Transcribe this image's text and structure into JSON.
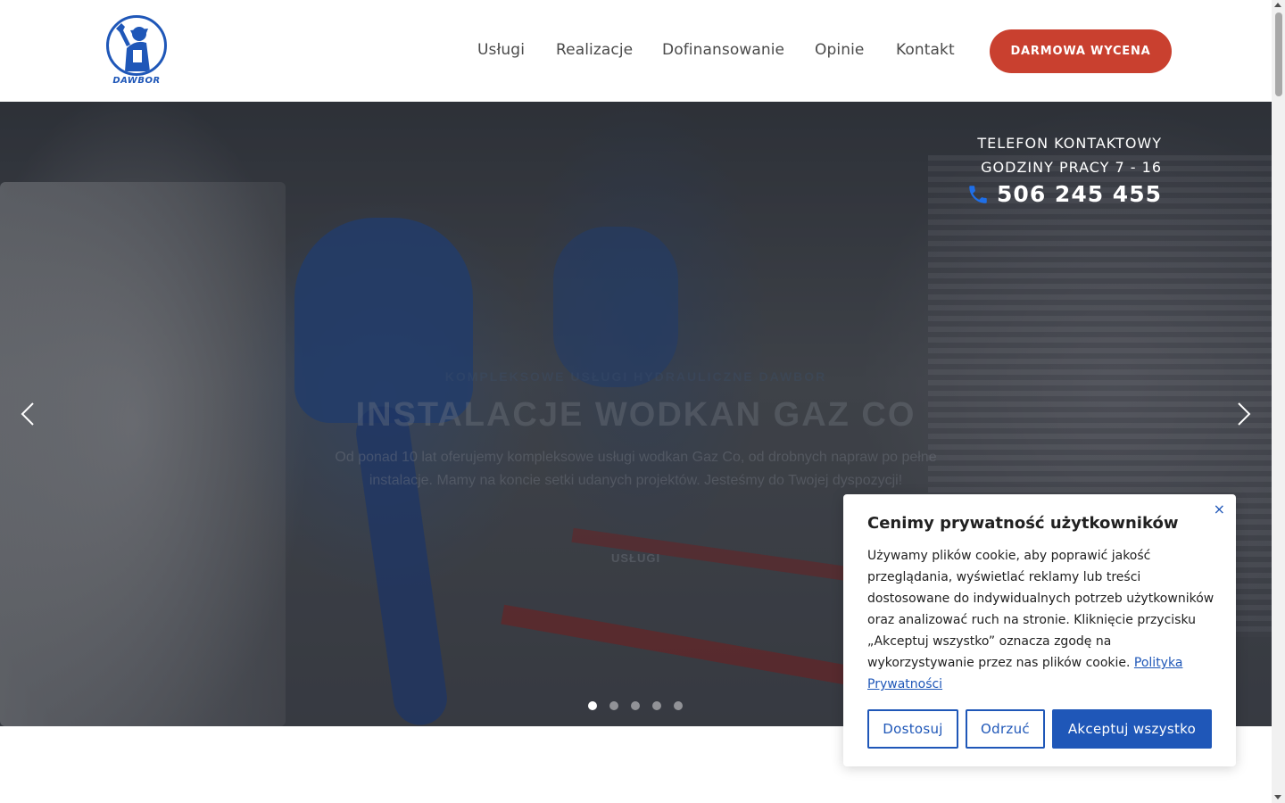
{
  "header": {
    "logo_text": "DAWBOR",
    "nav": [
      "Usługi",
      "Realizacje",
      "Dofinansowanie",
      "Opinie",
      "Kontakt"
    ],
    "cta_label": "DARMOWA WYCENA"
  },
  "hero": {
    "contact_label": "TELEFON KONTAKTOWY",
    "hours": "GODZINY PRACY 7 - 16",
    "phone": "506 245 455",
    "slide": {
      "subtitle": "KOMPLEKSOWE USŁUGI HYDRAULICZNE DAWBOR",
      "title": "INSTALACJE WODKAN GAZ CO",
      "text": "Od ponad 10 lat oferujemy kompleksowe usługi wodkan Gaz Co, od drobnych napraw po pełne instalacje. Mamy na koncie setki udanych projektów. Jesteśmy do Twojej dyspozycji!",
      "button": "USŁUGI"
    },
    "slides_count": 5,
    "active_slide": 1
  },
  "cookie": {
    "title": "Cenimy prywatność użytkowników",
    "body": "Używamy plików cookie, aby poprawić jakość przeglądania, wyświetlać reklamy lub treści dostosowane do indywidualnych potrzeb użytkowników oraz analizować ruch na stronie. Kliknięcie przycisku „Akceptuj wszystko” oznacza zgodę na wykorzystywanie przez nas plików cookie.",
    "link": "Polityka Prywatności",
    "close": "×",
    "btn_customize": "Dostosuj",
    "btn_reject": "Odrzuć",
    "btn_accept": "Akceptuj wszystko"
  },
  "colors": {
    "brand_blue": "#1f57b8",
    "cta_red": "#c9402f"
  }
}
